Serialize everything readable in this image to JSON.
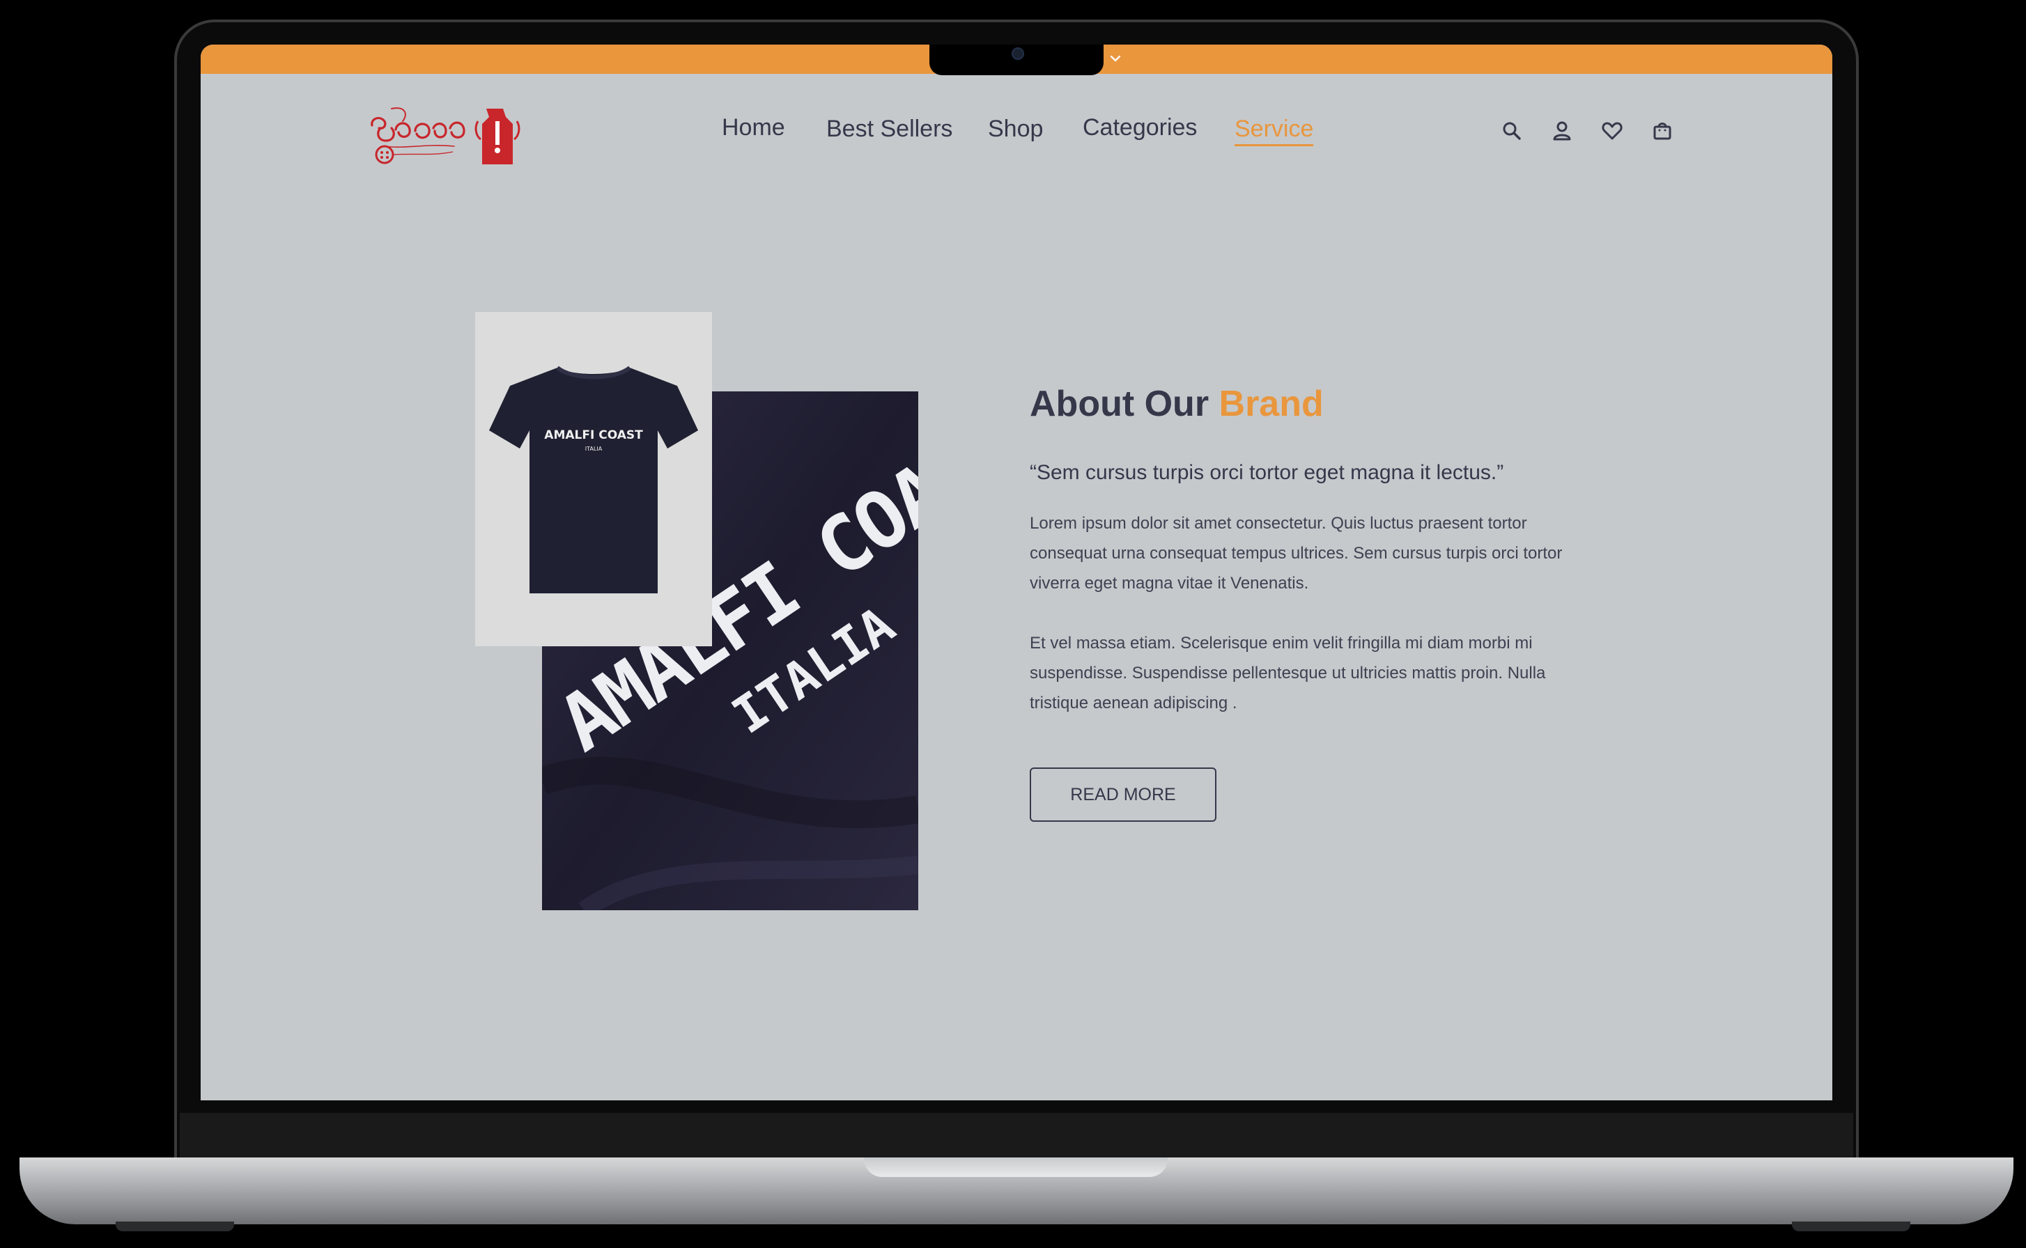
{
  "brand": {
    "logo_name": "myanmar-script-logo",
    "accent_color": "#e9963d",
    "logo_color": "#c8262b"
  },
  "nav": {
    "items": [
      {
        "label": "Home"
      },
      {
        "label": "Best Sellers"
      },
      {
        "label": "Shop"
      },
      {
        "label": "Categories"
      },
      {
        "label": "Service",
        "active": true
      }
    ]
  },
  "header_icons": [
    "search-icon",
    "user-icon",
    "heart-icon",
    "bag-icon"
  ],
  "about": {
    "title_main": "About Our ",
    "title_accent": "Brand",
    "quote": "“Sem cursus turpis orci tortor eget magna it lectus.”",
    "paragraph1": "Lorem ipsum dolor sit amet consectetur. Quis luctus praesent tortor consequat urna consequat tempus ultrices. Sem cursus turpis orci tortor viverra eget magna vitae it  Venenatis.",
    "paragraph2": "Et vel massa etiam. Scelerisque enim velit fringilla mi diam morbi mi suspendisse. Suspendisse pellentesque ut ultricies mattis proin. Nulla tristique aenean adipiscing .",
    "button_label": "READ MORE"
  },
  "product_images": {
    "shirt_print_line1": "AMALFI COAST",
    "shirt_print_line2": "ITALIA",
    "closeup_print_line1": "AMALFI COAST",
    "closeup_print_line2": "ITALIA"
  }
}
